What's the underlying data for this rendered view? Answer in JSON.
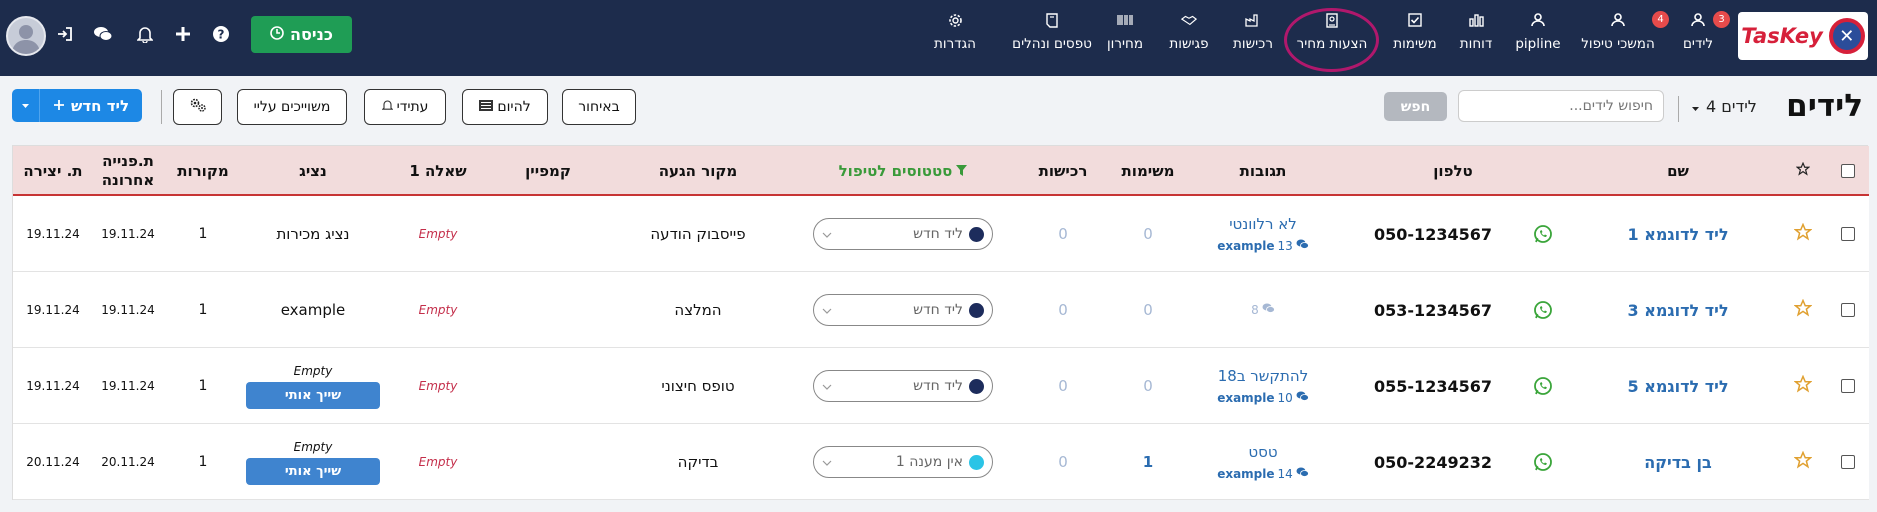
{
  "nav": {
    "brand": "TasKey",
    "items": [
      {
        "label": "לידים",
        "badge": "3",
        "icon": "person-icon"
      },
      {
        "label": "המשכי טיפול",
        "badge": "4",
        "icon": "person-icon"
      },
      {
        "label": "pipline",
        "icon": "person-icon"
      },
      {
        "label": "דוחות",
        "icon": "chart-icon"
      },
      {
        "label": "משימות",
        "icon": "checkbox-icon"
      },
      {
        "label": "הצעות מחיר",
        "icon": "document-icon"
      },
      {
        "label": "רכישות",
        "icon": "factory-icon"
      },
      {
        "label": "פגישות",
        "icon": "handshake-icon"
      },
      {
        "label": "מחירון",
        "icon": "barcode-icon"
      },
      {
        "label": "טפסים ונהלים",
        "icon": "form-icon"
      },
      {
        "label": "הגדרות",
        "icon": "gear-icon"
      }
    ],
    "enter_label": "כניסה"
  },
  "page": {
    "title": "לידים",
    "count": "4 לידים",
    "search_placeholder": "חיפוש לידים...",
    "search_btn": "חפש",
    "filters": [
      "באיחור",
      "להיום",
      "עתידי",
      "משוייכים עליי"
    ],
    "new_lead": "ליד חדש"
  },
  "columns": {
    "name": "שם",
    "phone": "טלפון",
    "responses": "תגובות",
    "tasks": "משימות",
    "purchases": "רכישות",
    "status": "סטטוסים לטיפול",
    "source": "מקור הגעה",
    "campaign": "קמפיין",
    "question": "שאלה 1",
    "rep": "נציג",
    "last_contact": "ת.פנייה אחרונה",
    "sources": "מקורות",
    "created": "ת. יצירה"
  },
  "rows": [
    {
      "name": "ליד לדוגמא 1",
      "phone": "050-1234567",
      "resp_main": "לא רלוונטי",
      "resp_count": "13",
      "resp_user": "example",
      "tasks": "0",
      "purchases": "0",
      "status": "ליד חדש",
      "status_color": "#1d2c5c",
      "source": "פייסבוק הודעה",
      "question": "Empty",
      "rep": "נציג מכירות",
      "last": "19.11.24",
      "sources": "1",
      "created": "19.11.24"
    },
    {
      "name": "ליד לדוגמא 3",
      "phone": "053-1234567",
      "resp_main": "",
      "resp_count": "8",
      "resp_user": "",
      "tasks": "0",
      "purchases": "0",
      "status": "ליד חדש",
      "status_color": "#1d2c5c",
      "source": "המלצה",
      "question": "Empty",
      "rep": "example",
      "last": "19.11.24",
      "sources": "1",
      "created": "19.11.24"
    },
    {
      "name": "ליד לדוגמא 5",
      "phone": "055-1234567",
      "resp_main": "להתקשר ב18",
      "resp_count": "10",
      "resp_user": "example",
      "tasks": "0",
      "purchases": "0",
      "status": "ליד חדש",
      "status_color": "#1d2c5c",
      "source": "טופס חיצוני",
      "question": "Empty",
      "rep_empty": "Empty",
      "assign": "שייך אותי",
      "last": "19.11.24",
      "sources": "1",
      "created": "19.11.24"
    },
    {
      "name": "בן בדיקה",
      "phone": "050-2249232",
      "resp_main": "טסט",
      "resp_count": "14",
      "resp_user": "example",
      "tasks": "1",
      "purchases": "0",
      "status": "אין מענה 1",
      "status_color": "#2bc4e6",
      "source": "בדיקה",
      "question": "Empty",
      "rep_empty": "Empty",
      "assign": "שייך אותי",
      "last": "20.11.24",
      "sources": "1",
      "created": "20.11.24"
    }
  ]
}
